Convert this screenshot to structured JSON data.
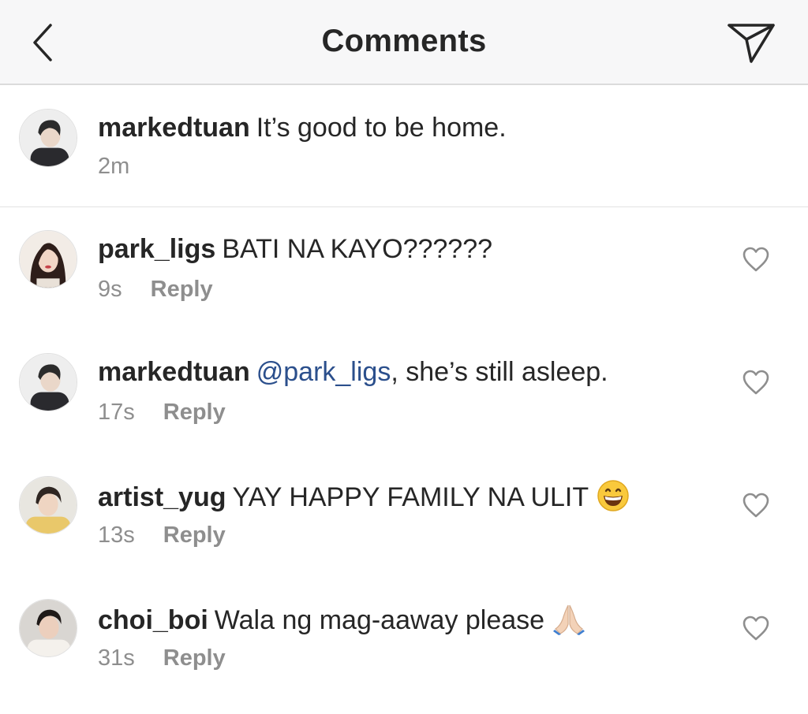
{
  "header": {
    "title": "Comments",
    "back_icon": "chevron-left-icon",
    "send_icon": "paper-plane-icon"
  },
  "caption": {
    "username": "markedtuan",
    "text": "It’s good to be home.",
    "time": "2m"
  },
  "comments": [
    {
      "username": "park_ligs",
      "text": "BATI NA KAYO??????",
      "time": "9s",
      "reply": "Reply"
    },
    {
      "username": "markedtuan",
      "mention": "@park_ligs",
      "text": ", she’s still asleep.",
      "time": "17s",
      "reply": "Reply"
    },
    {
      "username": "artist_yug",
      "text": "YAY HAPPY FAMILY NA ULIT",
      "emoji": "grinning-face-emoji",
      "time": "13s",
      "reply": "Reply"
    },
    {
      "username": "choi_boi",
      "text": "Wala ng mag-aaway please",
      "emoji": "folded-hands-emoji",
      "time": "31s",
      "reply": "Reply"
    }
  ],
  "colors": {
    "header_bg": "#f7f7f8",
    "text": "#262626",
    "muted": "#8e8e8e",
    "mention": "#2b4f8c",
    "divider": "#dbdbdb"
  }
}
